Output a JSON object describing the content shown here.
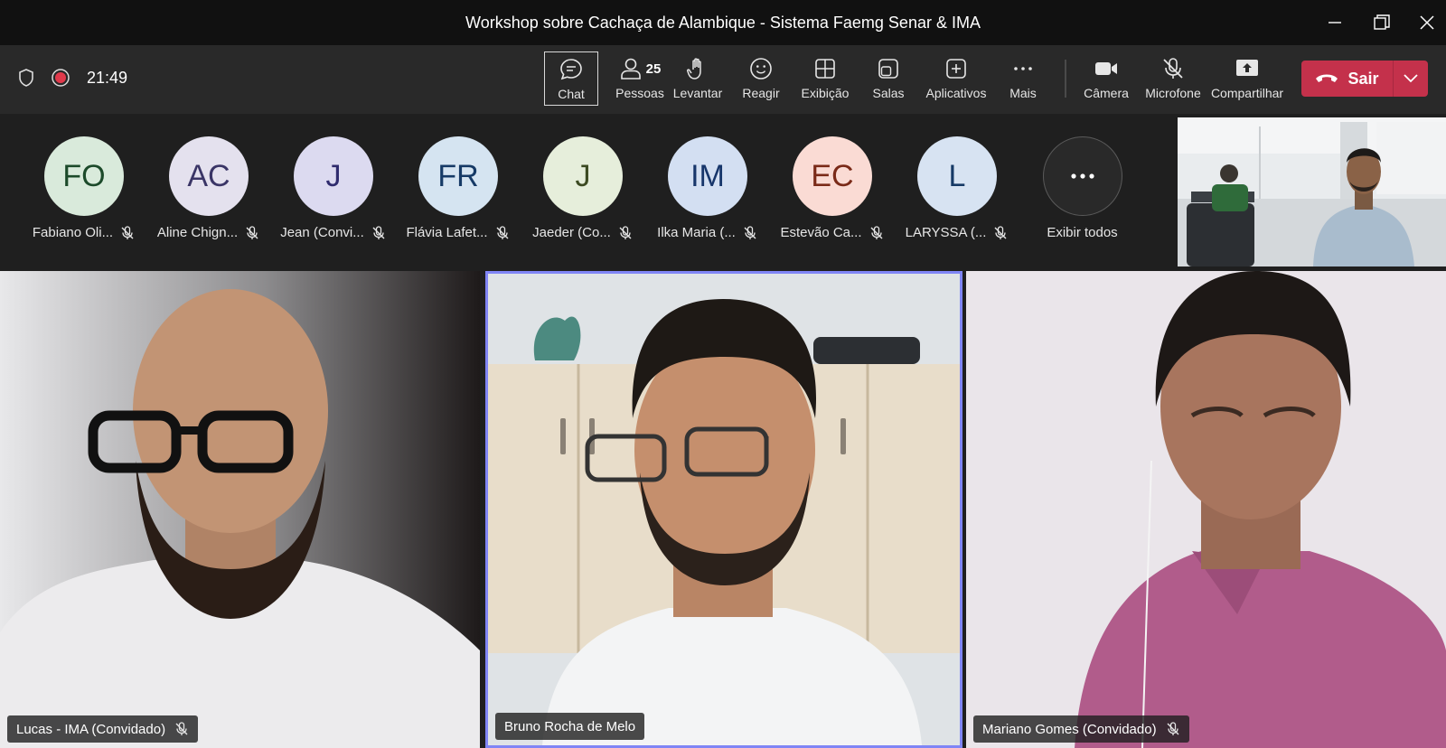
{
  "window": {
    "title": "Workshop sobre Cachaça de Alambique - Sistema Faemg Senar & IMA"
  },
  "meeting": {
    "timer": "21:49",
    "people_count": "25"
  },
  "toolbar": {
    "chat": "Chat",
    "people": "Pessoas",
    "raise": "Levantar",
    "react": "Reagir",
    "view": "Exibição",
    "rooms": "Salas",
    "apps": "Aplicativos",
    "more": "Mais",
    "camera": "Câmera",
    "mic": "Microfone",
    "share": "Compartilhar",
    "leave": "Sair"
  },
  "participants": [
    {
      "initials": "FO",
      "name": "Fabiano Oli...",
      "bg": "#d9eadb",
      "fg": "#1c4a2a"
    },
    {
      "initials": "AC",
      "name": "Aline Chign...",
      "bg": "#e4e1ee",
      "fg": "#3a3566"
    },
    {
      "initials": "J",
      "name": "Jean (Convi...",
      "bg": "#dcdaf0",
      "fg": "#2f2b6e"
    },
    {
      "initials": "FR",
      "name": "Flávia Lafet...",
      "bg": "#d5e4f1",
      "fg": "#163a66"
    },
    {
      "initials": "J",
      "name": "Jaeder (Co...",
      "bg": "#e6eedb",
      "fg": "#3c4a22"
    },
    {
      "initials": "IM",
      "name": "Ilka Maria (...",
      "bg": "#d3dff2",
      "fg": "#17366b"
    },
    {
      "initials": "EC",
      "name": "Estevão Ca...",
      "bg": "#fadbd4",
      "fg": "#7a2a18"
    },
    {
      "initials": "L",
      "name": "LARYSSA (...",
      "bg": "#d7e3f2",
      "fg": "#163a66"
    }
  ],
  "show_all": {
    "label": "Exibir todos"
  },
  "tiles": [
    {
      "name": "Lucas - IMA (Convidado)"
    },
    {
      "name": "Bruno Rocha de Melo"
    },
    {
      "name": "Mariano Gomes (Convidado)"
    }
  ]
}
